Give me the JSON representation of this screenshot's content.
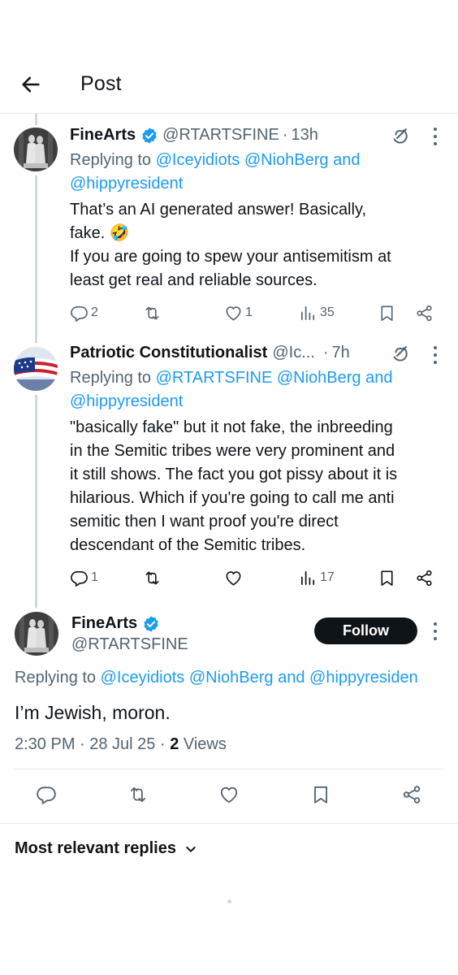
{
  "header": {
    "title": "Post"
  },
  "tweets": [
    {
      "name": "FineArts",
      "handle": "@RTARTSFINE",
      "time": "13h",
      "replying_prefix": "Replying to ",
      "mentions": [
        "@Iceyidiots",
        "@NiohBerg"
      ],
      "replying_and": " and",
      "mention_last": "@hippyresident",
      "lines": [
        "That’s an AI generated answer! Basically,",
        "fake. 🤣",
        "If you are going to spew your antisemitism at",
        "least get real and reliable sources."
      ],
      "stats": {
        "replies": "2",
        "reposts": "",
        "likes": "1",
        "views": "35"
      }
    },
    {
      "name": "Patriotic Constitutionalist",
      "handle": "@Ic...",
      "time": "7h",
      "replying_prefix": "Replying to ",
      "mentions": [
        "@RTARTSFINE",
        "@NiohBerg"
      ],
      "replying_and": " and",
      "mention_last": "@hippyresident",
      "lines": [
        "\"basically fake\" but it not fake, the inbreeding",
        "in the Semitic tribes were very prominent and",
        "it still shows. The fact you got pissy about it  is",
        "hilarious. Which if you're going to call me anti",
        "semitic then I want proof you're direct",
        "descendant of the Semitic tribes."
      ],
      "stats": {
        "replies": "1",
        "reposts": "",
        "likes": "",
        "views": "17"
      }
    }
  ],
  "main_post": {
    "name": "FineArts",
    "handle": "@RTARTSFINE",
    "follow_label": "Follow",
    "replying_prefix": "Replying to ",
    "mention_1": "@Iceyidiots",
    "mention_2": "@NiohBerg",
    "replying_and": " and ",
    "mention_3": "@hippyresiden",
    "text": "I’m Jewish, moron.",
    "timestamp": "2:30 PM · 28 Jul 25 · ",
    "views_count": "2",
    "views_label": " Views"
  },
  "sort": {
    "label": "Most relevant replies"
  },
  "icons": {
    "back": "arrow-left-icon",
    "verified": "verified-badge-icon",
    "grok": "grok-icon",
    "more": "more-vertical-icon",
    "reply": "reply-icon",
    "repost": "repost-icon",
    "like": "heart-icon",
    "views": "views-chart-icon",
    "bookmark": "bookmark-icon",
    "share": "share-icon",
    "chevron": "chevron-down-icon"
  },
  "colors": {
    "accent": "#1d9bf0",
    "text": "#0f1419",
    "muted": "#536471",
    "border": "#e6e8ea"
  }
}
